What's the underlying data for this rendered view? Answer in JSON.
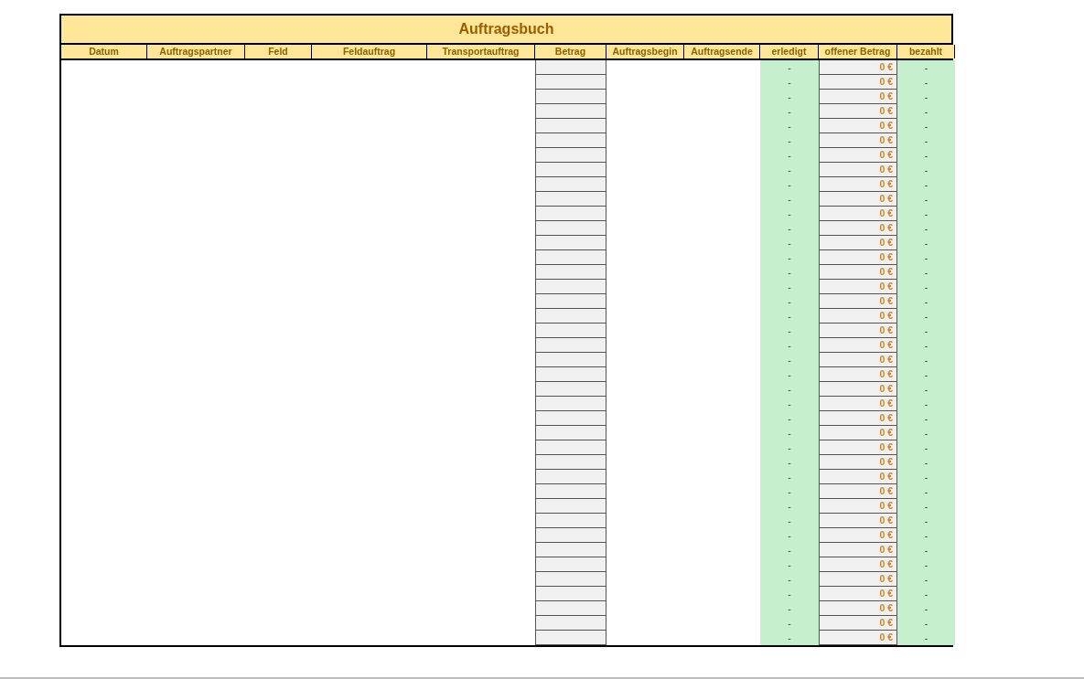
{
  "title": "Auftragsbuch",
  "columns": [
    "Datum",
    "Auftragspartner",
    "Feld",
    "Feldauftrag",
    "Transportauftrag",
    "Betrag",
    "Auftragsbegin",
    "Auftragsende",
    "erledigt",
    "offener Betrag",
    "bezahlt"
  ],
  "rows": [
    {
      "erledigt": "-",
      "offener_betrag": "0 €",
      "bezahlt": "-"
    },
    {
      "erledigt": "-",
      "offener_betrag": "0 €",
      "bezahlt": "-"
    },
    {
      "erledigt": "-",
      "offener_betrag": "0 €",
      "bezahlt": "-"
    },
    {
      "erledigt": "-",
      "offener_betrag": "0 €",
      "bezahlt": "-"
    },
    {
      "erledigt": "-",
      "offener_betrag": "0 €",
      "bezahlt": "-"
    },
    {
      "erledigt": "-",
      "offener_betrag": "0 €",
      "bezahlt": "-"
    },
    {
      "erledigt": "-",
      "offener_betrag": "0 €",
      "bezahlt": "-"
    },
    {
      "erledigt": "-",
      "offener_betrag": "0 €",
      "bezahlt": "-"
    },
    {
      "erledigt": "-",
      "offener_betrag": "0 €",
      "bezahlt": "-"
    },
    {
      "erledigt": "-",
      "offener_betrag": "0 €",
      "bezahlt": "-"
    },
    {
      "erledigt": "-",
      "offener_betrag": "0 €",
      "bezahlt": "-"
    },
    {
      "erledigt": "-",
      "offener_betrag": "0 €",
      "bezahlt": "-"
    },
    {
      "erledigt": "-",
      "offener_betrag": "0 €",
      "bezahlt": "-"
    },
    {
      "erledigt": "-",
      "offener_betrag": "0 €",
      "bezahlt": "-"
    },
    {
      "erledigt": "-",
      "offener_betrag": "0 €",
      "bezahlt": "-"
    },
    {
      "erledigt": "-",
      "offener_betrag": "0 €",
      "bezahlt": "-"
    },
    {
      "erledigt": "-",
      "offener_betrag": "0 €",
      "bezahlt": "-"
    },
    {
      "erledigt": "-",
      "offener_betrag": "0 €",
      "bezahlt": "-"
    },
    {
      "erledigt": "-",
      "offener_betrag": "0 €",
      "bezahlt": "-"
    },
    {
      "erledigt": "-",
      "offener_betrag": "0 €",
      "bezahlt": "-"
    },
    {
      "erledigt": "-",
      "offener_betrag": "0 €",
      "bezahlt": "-"
    },
    {
      "erledigt": "-",
      "offener_betrag": "0 €",
      "bezahlt": "-"
    },
    {
      "erledigt": "-",
      "offener_betrag": "0 €",
      "bezahlt": "-"
    },
    {
      "erledigt": "-",
      "offener_betrag": "0 €",
      "bezahlt": "-"
    },
    {
      "erledigt": "-",
      "offener_betrag": "0 €",
      "bezahlt": "-"
    },
    {
      "erledigt": "-",
      "offener_betrag": "0 €",
      "bezahlt": "-"
    },
    {
      "erledigt": "-",
      "offener_betrag": "0 €",
      "bezahlt": "-"
    },
    {
      "erledigt": "-",
      "offener_betrag": "0 €",
      "bezahlt": "-"
    },
    {
      "erledigt": "-",
      "offener_betrag": "0 €",
      "bezahlt": "-"
    },
    {
      "erledigt": "-",
      "offener_betrag": "0 €",
      "bezahlt": "-"
    },
    {
      "erledigt": "-",
      "offener_betrag": "0 €",
      "bezahlt": "-"
    },
    {
      "erledigt": "-",
      "offener_betrag": "0 €",
      "bezahlt": "-"
    },
    {
      "erledigt": "-",
      "offener_betrag": "0 €",
      "bezahlt": "-"
    },
    {
      "erledigt": "-",
      "offener_betrag": "0 €",
      "bezahlt": "-"
    },
    {
      "erledigt": "-",
      "offener_betrag": "0 €",
      "bezahlt": "-"
    },
    {
      "erledigt": "-",
      "offener_betrag": "0 €",
      "bezahlt": "-"
    },
    {
      "erledigt": "-",
      "offener_betrag": "0 €",
      "bezahlt": "-"
    },
    {
      "erledigt": "-",
      "offener_betrag": "0 €",
      "bezahlt": "-"
    },
    {
      "erledigt": "-",
      "offener_betrag": "0 €",
      "bezahlt": "-"
    },
    {
      "erledigt": "-",
      "offener_betrag": "0 €",
      "bezahlt": "-"
    }
  ]
}
